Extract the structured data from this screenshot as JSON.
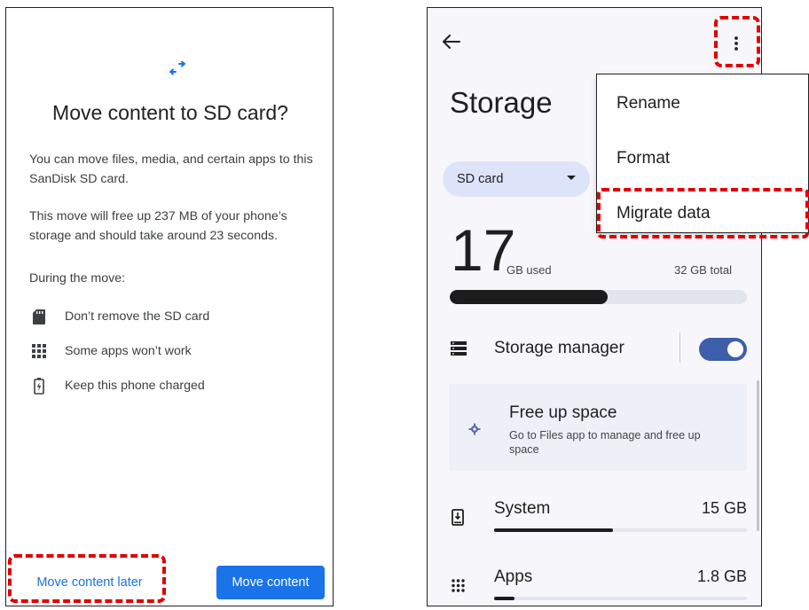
{
  "left_screen": {
    "title": "Move content to SD card?",
    "paragraph1": "You can move files, media, and certain apps to this SanDisk SD card.",
    "paragraph2": "This move will free up 237 MB of your phone’s storage and should take around 23 seconds.",
    "during_label": "During the move:",
    "items": [
      {
        "icon": "sd-card-icon",
        "label": "Don’t remove the SD card"
      },
      {
        "icon": "apps-grid-icon",
        "label": "Some apps won’t work"
      },
      {
        "icon": "battery-charging-icon",
        "label": "Keep this phone charged"
      }
    ],
    "later_button": "Move content later",
    "move_button": "Move content",
    "accent_color": "#1a73e8"
  },
  "right_screen": {
    "title": "Storage",
    "volume_selector": "SD card",
    "used_number": "17",
    "used_unit": "GB used",
    "total": "32 GB total",
    "used_fraction": 0.53,
    "storage_manager_label": "Storage manager",
    "storage_manager_enabled": true,
    "free_up": {
      "title": "Free up space",
      "subtitle": "Go to Files app to manage and free up space"
    },
    "categories": [
      {
        "name": "System",
        "size": "15 GB",
        "fraction": 0.47
      },
      {
        "name": "Apps",
        "size": "1.8 GB",
        "fraction": 0.08
      }
    ],
    "menu": {
      "items": [
        "Rename",
        "Format",
        "Migrate data"
      ]
    }
  },
  "highlight_color": "#e00000"
}
